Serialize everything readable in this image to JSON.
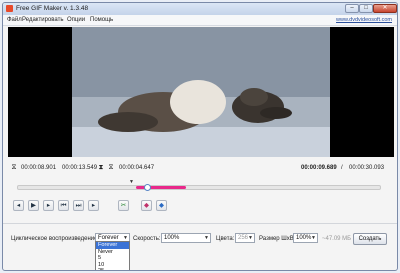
{
  "window": {
    "title": "Free GIF Maker v. 1.3.48"
  },
  "menu": {
    "items": [
      "Файл",
      "Редактировать",
      "Опции",
      "Помощь"
    ],
    "link": "www.dvdvideosoft.com"
  },
  "times": {
    "start": "00:00:08.901",
    "end": "00:00:13.549",
    "duration": "00:00:04.647",
    "current": "00:00:09.689",
    "separator": "/",
    "total": "00:00:30.093"
  },
  "timeline": {
    "position_fraction": 0.33
  },
  "loop": {
    "label": "Циклическое воспроизведение:",
    "value": "Forever",
    "options": [
      "Forever",
      "Never",
      "5",
      "10",
      "25"
    ]
  },
  "speed": {
    "label": "Скорость:",
    "value": "100%"
  },
  "colors": {
    "label": "Цвета:",
    "value": "256"
  },
  "size": {
    "label": "Размер ШхВ:",
    "value": "100%"
  },
  "filesize": "~47.09 МБ",
  "create_label": "Создать",
  "colors_hex": {
    "accent": "#e8288a",
    "highlight": "#3b73d6",
    "app": "#e84a2a"
  }
}
